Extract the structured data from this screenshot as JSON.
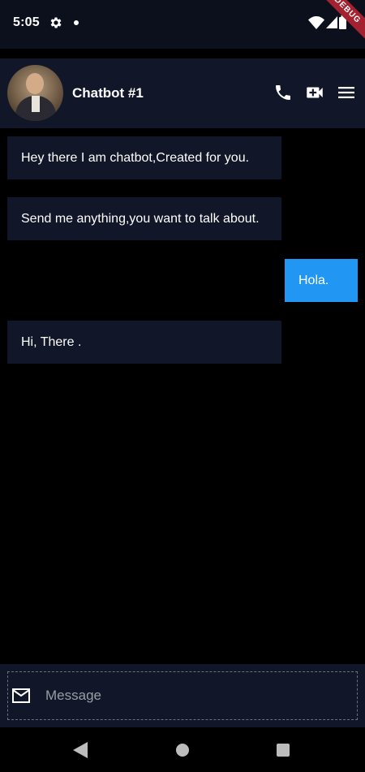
{
  "status_bar": {
    "time": "5:05",
    "debug_banner": "DEBUG",
    "icons": [
      "gear-icon",
      "notification-dot-icon",
      "wifi-icon",
      "signal-icon",
      "battery-icon"
    ]
  },
  "header": {
    "title": "Chatbot #1",
    "avatar": "avatar-image",
    "actions": [
      "phone-icon",
      "video-call-icon",
      "menu-icon"
    ]
  },
  "messages": [
    {
      "sender": "bot",
      "text": "Hey there I am chatbot,Created for you."
    },
    {
      "sender": "bot",
      "text": "Send me anything,you want to talk about."
    },
    {
      "sender": "user",
      "text": "Hola."
    },
    {
      "sender": "bot",
      "text": "Hi, There ."
    }
  ],
  "composer": {
    "placeholder": "Message",
    "value": "",
    "icon": "mail-icon"
  },
  "nav_bar": {
    "icons": [
      "back-icon",
      "home-icon",
      "recents-icon"
    ]
  },
  "colors": {
    "background": "#000000",
    "surface": "#111628",
    "user_bubble": "#2196f3",
    "text": "#ffffff",
    "placeholder": "#9a9ca6"
  }
}
